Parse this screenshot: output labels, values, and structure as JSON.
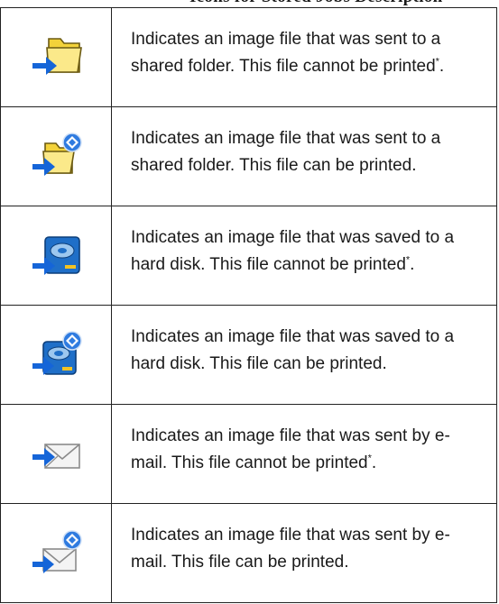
{
  "header": {
    "title": "Icons for Stored Jobs Description"
  },
  "rows": [
    {
      "icon": "folder-send-icon",
      "text": "Indicates an image file that was sent to a shared folder. This file cannot be printed",
      "suffix": "."
    },
    {
      "icon": "folder-send-printable-icon",
      "text": "Indicates an image file that was sent to a shared folder. This file can be printed.",
      "suffix": ""
    },
    {
      "icon": "hard-disk-save-icon",
      "text": "Indicates an image file that was saved to a hard disk. This file cannot be printed",
      "suffix": "."
    },
    {
      "icon": "hard-disk-save-printable-icon",
      "text": "Indicates an image file that was saved to a hard disk. This file can be printed.",
      "suffix": ""
    },
    {
      "icon": "email-send-icon",
      "text": "Indicates an image file that was sent by e-mail. This file cannot be printed",
      "suffix": "."
    },
    {
      "icon": "email-send-printable-icon",
      "text": "Indicates an image file that was sent by e-mail. This file can be printed.",
      "suffix": ""
    }
  ],
  "footnote_marker": "*",
  "colors": {
    "arrow": "#1565d8",
    "folder": "#f3d23a",
    "disk": "#1f6fc8",
    "badge": "#2f7be0"
  }
}
